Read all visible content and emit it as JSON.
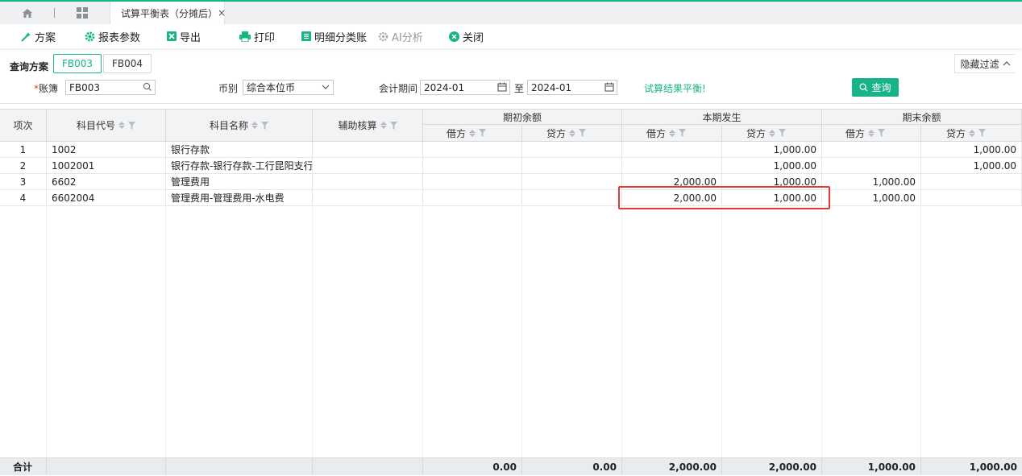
{
  "tabs": {
    "active_tab": "试算平衡表（分摊后）",
    "close_glyph": "×"
  },
  "toolbar": {
    "plan": "方案",
    "report_params": "报表参数",
    "export": "导出",
    "print": "打印",
    "detail_ledger": "明细分类账",
    "ai_analysis": "AI分析",
    "close": "关闭"
  },
  "query_plan": {
    "label": "查询方案",
    "options": [
      "FB003",
      "FB004"
    ],
    "selected": "FB003",
    "hide_filter": "隐藏过滤"
  },
  "filters": {
    "ledger_label": "账簿",
    "ledger_required_mark": "*",
    "ledger_value": "FB003",
    "currency_label": "币别",
    "currency_value": "综合本位币",
    "period_label": "会计期间",
    "period_from": "2024-01",
    "period_to_label": "至",
    "period_to": "2024-01",
    "status_text": "试算结果平衡!",
    "query_button": "查询"
  },
  "table": {
    "headers": {
      "seq": "项次",
      "account_code": "科目代号",
      "account_name": "科目名称",
      "aux": "辅助核算",
      "opening": "期初余额",
      "current": "本期发生",
      "closing": "期末余额",
      "debit": "借方",
      "credit": "贷方"
    },
    "rows": [
      {
        "seq": "1",
        "code": "1002",
        "name": "银行存款",
        "aux": "",
        "open_dr": "",
        "open_cr": "",
        "cur_dr": "",
        "cur_cr": "1,000.00",
        "close_dr": "",
        "close_cr": "1,000.00"
      },
      {
        "seq": "2",
        "code": "1002001",
        "name": "银行存款-银行存款-工行昆阳支行...",
        "aux": "",
        "open_dr": "",
        "open_cr": "",
        "cur_dr": "",
        "cur_cr": "1,000.00",
        "close_dr": "",
        "close_cr": "1,000.00"
      },
      {
        "seq": "3",
        "code": "6602",
        "name": "管理费用",
        "aux": "",
        "open_dr": "",
        "open_cr": "",
        "cur_dr": "2,000.00",
        "cur_cr": "1,000.00",
        "close_dr": "1,000.00",
        "close_cr": ""
      },
      {
        "seq": "4",
        "code": "6602004",
        "name": "管理费用-管理费用-水电费",
        "aux": "",
        "open_dr": "",
        "open_cr": "",
        "cur_dr": "2,000.00",
        "cur_cr": "1,000.00",
        "close_dr": "1,000.00",
        "close_cr": ""
      }
    ],
    "totals": {
      "label": "合计",
      "open_dr": "0.00",
      "open_cr": "0.00",
      "cur_dr": "2,000.00",
      "cur_cr": "2,000.00",
      "close_dr": "1,000.00",
      "close_cr": "1,000.00"
    }
  },
  "colors": {
    "accent": "#19b38a",
    "highlight": "#e53935"
  }
}
